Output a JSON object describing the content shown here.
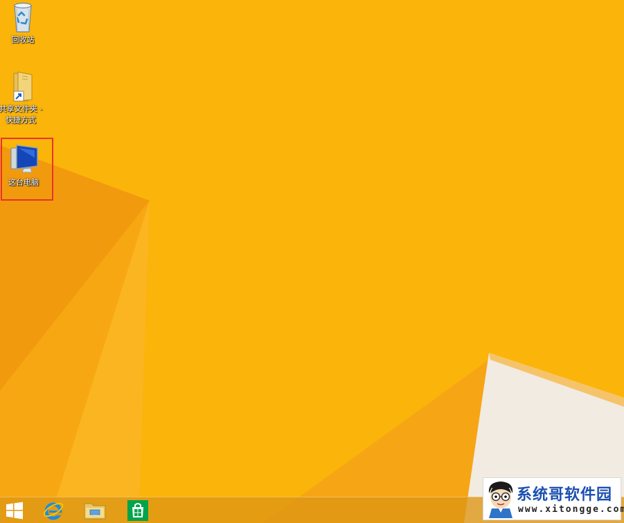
{
  "desktop": {
    "icons": [
      {
        "label": "回收站",
        "icon": "recycle-bin-icon"
      },
      {
        "label_line1": "共享文件夹 -",
        "label_line2": "快捷方式",
        "icon": "shared-folder-shortcut-icon"
      },
      {
        "label": "这台电脑",
        "icon": "this-pc-icon"
      }
    ],
    "highlight_color": "#e8332a"
  },
  "taskbar": {
    "buttons": [
      {
        "icon": "windows-start-icon"
      },
      {
        "icon": "internet-explorer-icon"
      },
      {
        "icon": "file-explorer-icon"
      },
      {
        "icon": "windows-store-icon"
      }
    ]
  },
  "watermark": {
    "title": "系统哥软件园",
    "url": "www.xitongge.com"
  },
  "colors": {
    "wallpaper": "#fbb40a",
    "accent": "#e8332a",
    "watermark_title": "#1b4fb0"
  }
}
